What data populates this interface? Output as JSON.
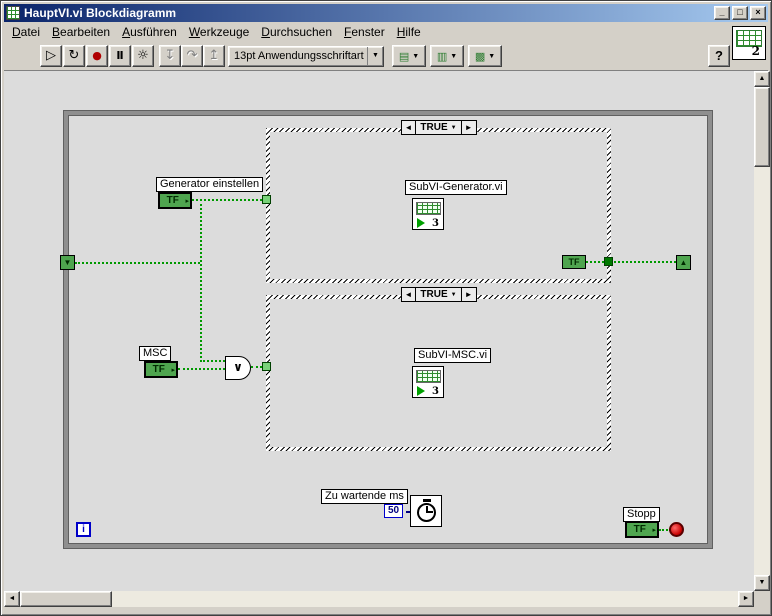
{
  "window": {
    "title": "HauptVI.vi Blockdiagramm",
    "minimize": "_",
    "maximize": "□",
    "close": "×"
  },
  "menu": {
    "items": [
      "Datei",
      "Bearbeiten",
      "Ausführen",
      "Werkzeuge",
      "Durchsuchen",
      "Fenster",
      "Hilfe"
    ]
  },
  "toolbar": {
    "run_glyph": "▷",
    "run_continuous_glyph": "↻",
    "abort_glyph": "●",
    "pause_glyph": "Ⅱ",
    "highlight_glyph": "☼",
    "step_into_glyph": "↧",
    "step_over_glyph": "↷",
    "step_out_glyph": "↥",
    "font_selector": "13pt Anwendungsschriftart",
    "dropdown_arrow": "▼",
    "align_glyph": "▤",
    "distribute_glyph": "▥",
    "reorder_glyph": "▩",
    "help": "?"
  },
  "vi_icon_number": "2",
  "diagram": {
    "iteration_label": "i",
    "or_symbol": "∨",
    "tf_arrow": "▸",
    "selector_dropdown": "▼",
    "shift_register_left": "▼",
    "shift_register_right": "▲",
    "case_generator": {
      "prev": "◄",
      "next": "►",
      "selector": "TRUE",
      "subvi_label": "SubVI-Generator.vi",
      "subvi_number": "3"
    },
    "case_msc": {
      "prev": "◄",
      "next": "►",
      "selector": "TRUE",
      "subvi_label": "SubVI-MSC.vi",
      "subvi_number": "3"
    },
    "generator_control": {
      "label": "Generator einstellen",
      "terminal": "TF"
    },
    "msc_control": {
      "label": "MSC",
      "terminal": "TF"
    },
    "stop_control": {
      "label": "Stopp",
      "terminal": "TF"
    },
    "tf_indicator": "TF",
    "wait": {
      "label": "Zu wartende ms",
      "value": "50"
    }
  },
  "scrollbars": {
    "up": "▲",
    "down": "▼",
    "left": "◄",
    "right": "►"
  },
  "colors": {
    "titlebar_start": "#0A246A",
    "titlebar_end": "#A6CAF0",
    "chrome": "#D4D0C8",
    "diagram_bg": "#DCDCDC",
    "boolean_green": "#4FA54F",
    "wire_green": "#009900",
    "numeric_blue": "#00007F",
    "abort_red": "#B00000"
  }
}
